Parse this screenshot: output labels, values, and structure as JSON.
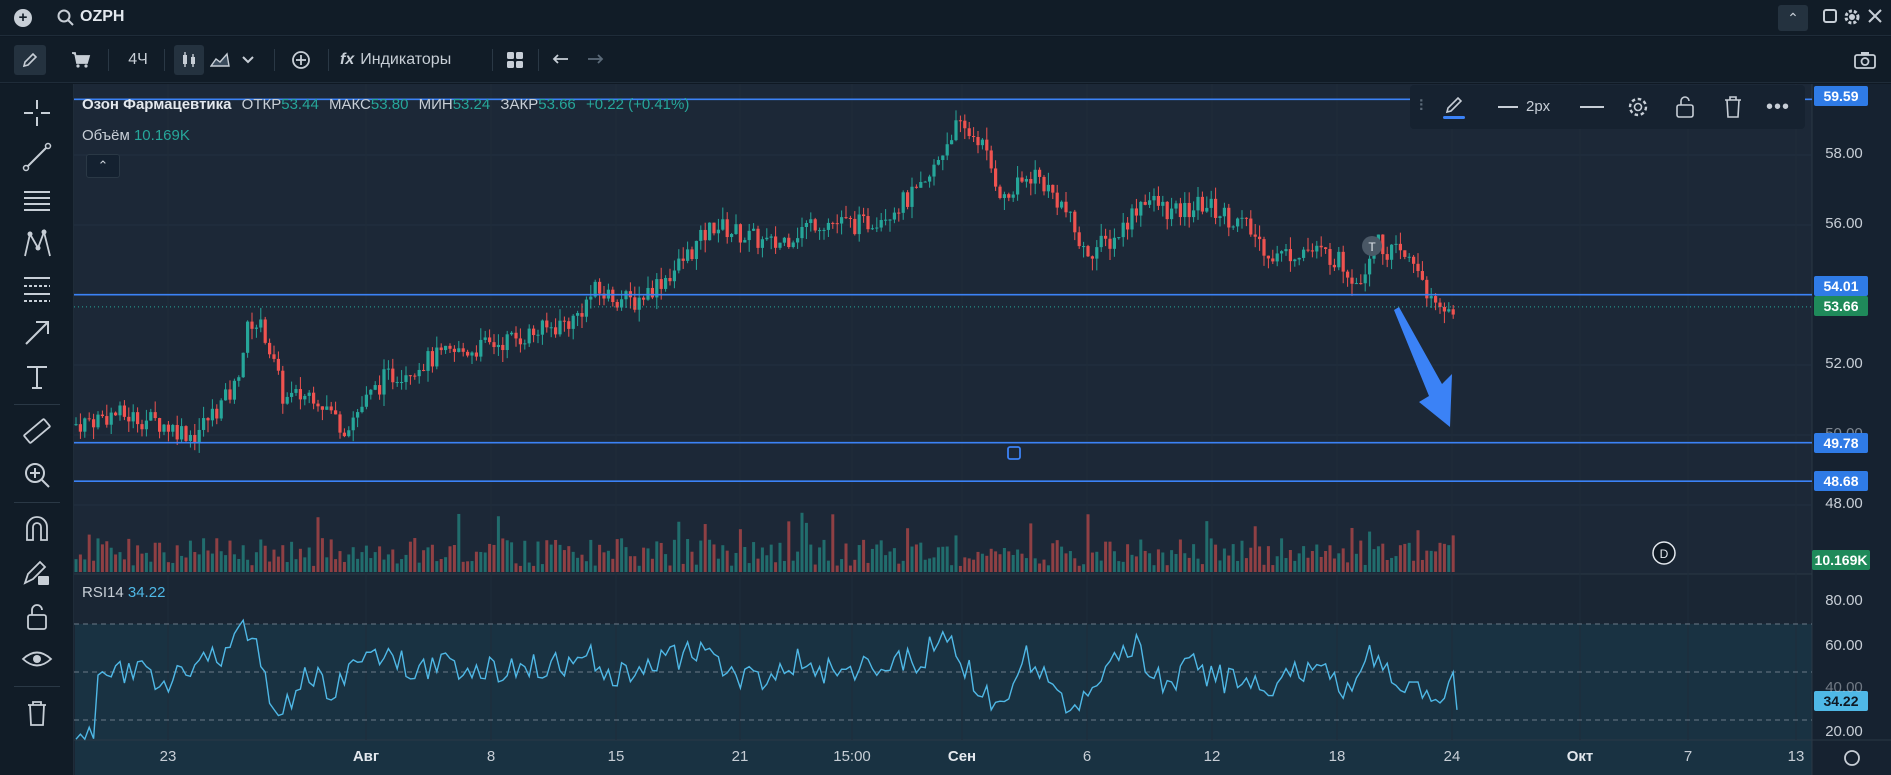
{
  "search": {
    "ticker": "OZPH"
  },
  "toolbar": {
    "timeframe": "4Ч",
    "indicators_label": "Индикаторы"
  },
  "legend": {
    "name": "Озон Фармацевтика",
    "open_label": "ОТКР",
    "open": "53.44",
    "high_label": "МАКС",
    "high": "53.80",
    "low_label": "МИН",
    "low": "53.24",
    "close_label": "ЗАКР",
    "close": "53.66",
    "change": "+0.22 (+0.41%)",
    "volume_label": "Объём",
    "volume": "10.169K"
  },
  "rsi": {
    "label": "RSI14",
    "value": "34.22"
  },
  "drawbar": {
    "width_label": "2px"
  },
  "price_axis": {
    "ticks": [
      "58.00",
      "56.00",
      "52.00",
      "48.00"
    ],
    "hidden_tick": "50.00",
    "tags": [
      {
        "value": "59.59",
        "color": "#2f7be6"
      },
      {
        "value": "54.01",
        "color": "#2f7be6"
      },
      {
        "value": "53.66",
        "color": "#1f8a5a"
      },
      {
        "value": "49.78",
        "color": "#2f7be6"
      },
      {
        "value": "48.68",
        "color": "#2f7be6"
      },
      {
        "value": "10.169K",
        "color": "#1f8a5a"
      },
      {
        "value": "34.22",
        "color": "#4fb8e6"
      }
    ]
  },
  "rsi_axis": {
    "ticks": [
      "80.00",
      "60.00",
      "40.00",
      "20.00"
    ]
  },
  "time_axis": [
    "23",
    "Авг",
    "8",
    "15",
    "21",
    "15:00",
    "Сен",
    "6",
    "12",
    "18",
    "24",
    "Окт",
    "7",
    "13"
  ],
  "markers": {
    "t": "T",
    "d": "D"
  },
  "colors": {
    "up": "#26a69a",
    "down": "#ef5350",
    "line": "#3b82f6",
    "rsi": "#4fb8e6",
    "bg": "#1a2634"
  },
  "chart_data": {
    "type": "candlestick",
    "symbol": "OZPH",
    "ylim": [
      47.2,
      60.2
    ],
    "horizontal_levels": [
      59.59,
      54.01,
      49.78,
      48.68
    ],
    "last_price": 53.66,
    "rsi_levels": [
      70,
      50,
      30
    ],
    "rsi_ylim": [
      15,
      90
    ],
    "rsi_last": 34.22
  }
}
